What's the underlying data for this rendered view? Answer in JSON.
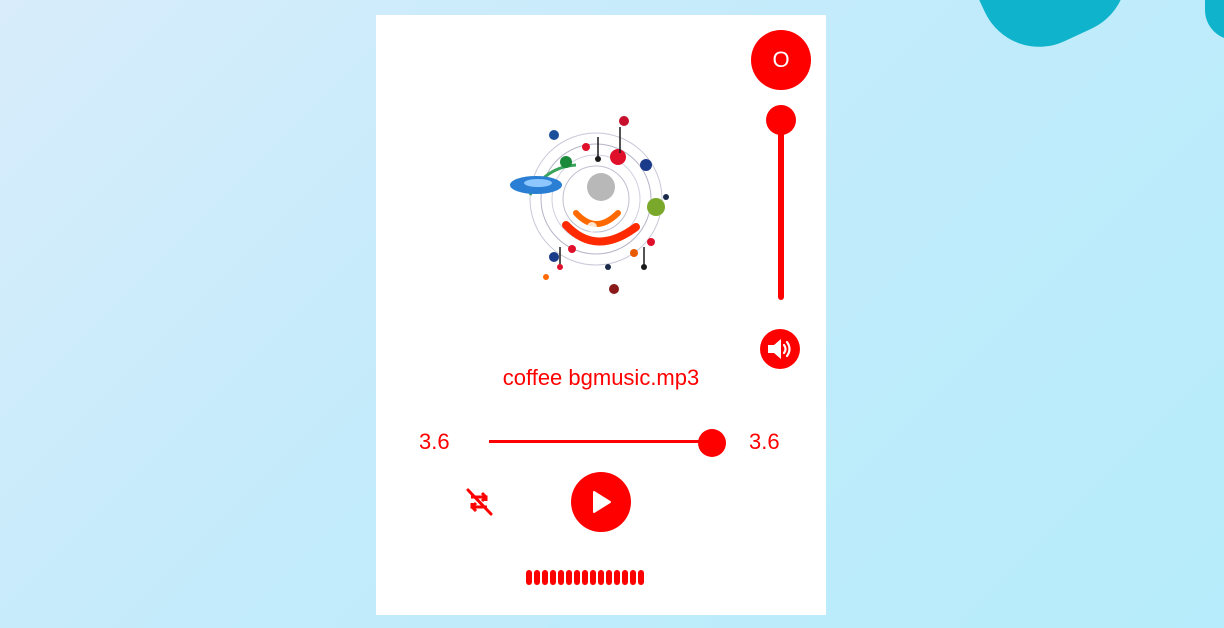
{
  "player": {
    "top_button_label": "O",
    "song_title": "coffee bgmusic.mp3",
    "current_time": "3.6",
    "total_time": "3.6",
    "progress_fraction": 1.0,
    "volume_fraction": 1.0,
    "visualizer_bar_count": 15
  },
  "icons": {
    "volume": "speaker-volume-icon",
    "repeat": "repeat-off-icon",
    "play": "play-icon",
    "album_art": "music-notes-art"
  },
  "colors": {
    "accent": "#ff0000",
    "card": "#ffffff",
    "background": "#c3ebfb",
    "decor": "#0fb4cc"
  }
}
